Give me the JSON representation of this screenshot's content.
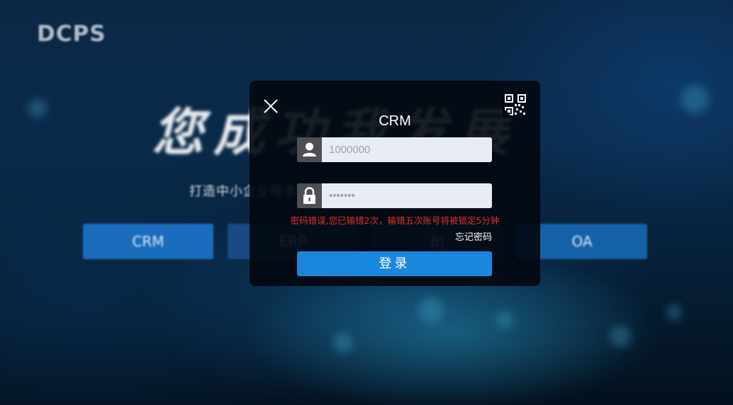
{
  "background": {
    "logo": "DCPS",
    "slogan": "您成功我发展",
    "tagline": "打造中小企业降本增效一体化数字化服务平台",
    "systems": [
      "CRM",
      "ERP",
      "BI",
      "OA"
    ]
  },
  "modal": {
    "title": "CRM",
    "close_icon": "close-icon",
    "qr_icon": "qrcode-icon",
    "username_icon": "user-icon",
    "username_value": "1000000",
    "password_icon": "lock-icon",
    "password_value": "•••••••",
    "error": "密码错误,您已输错2次，输错五次账号将被锁定5分钟",
    "forgot_label": "忘记密码",
    "login_label": "登录"
  },
  "colors": {
    "accent": "#1a86dc",
    "error": "#e0322b",
    "system_button": "#1a6dbd"
  }
}
